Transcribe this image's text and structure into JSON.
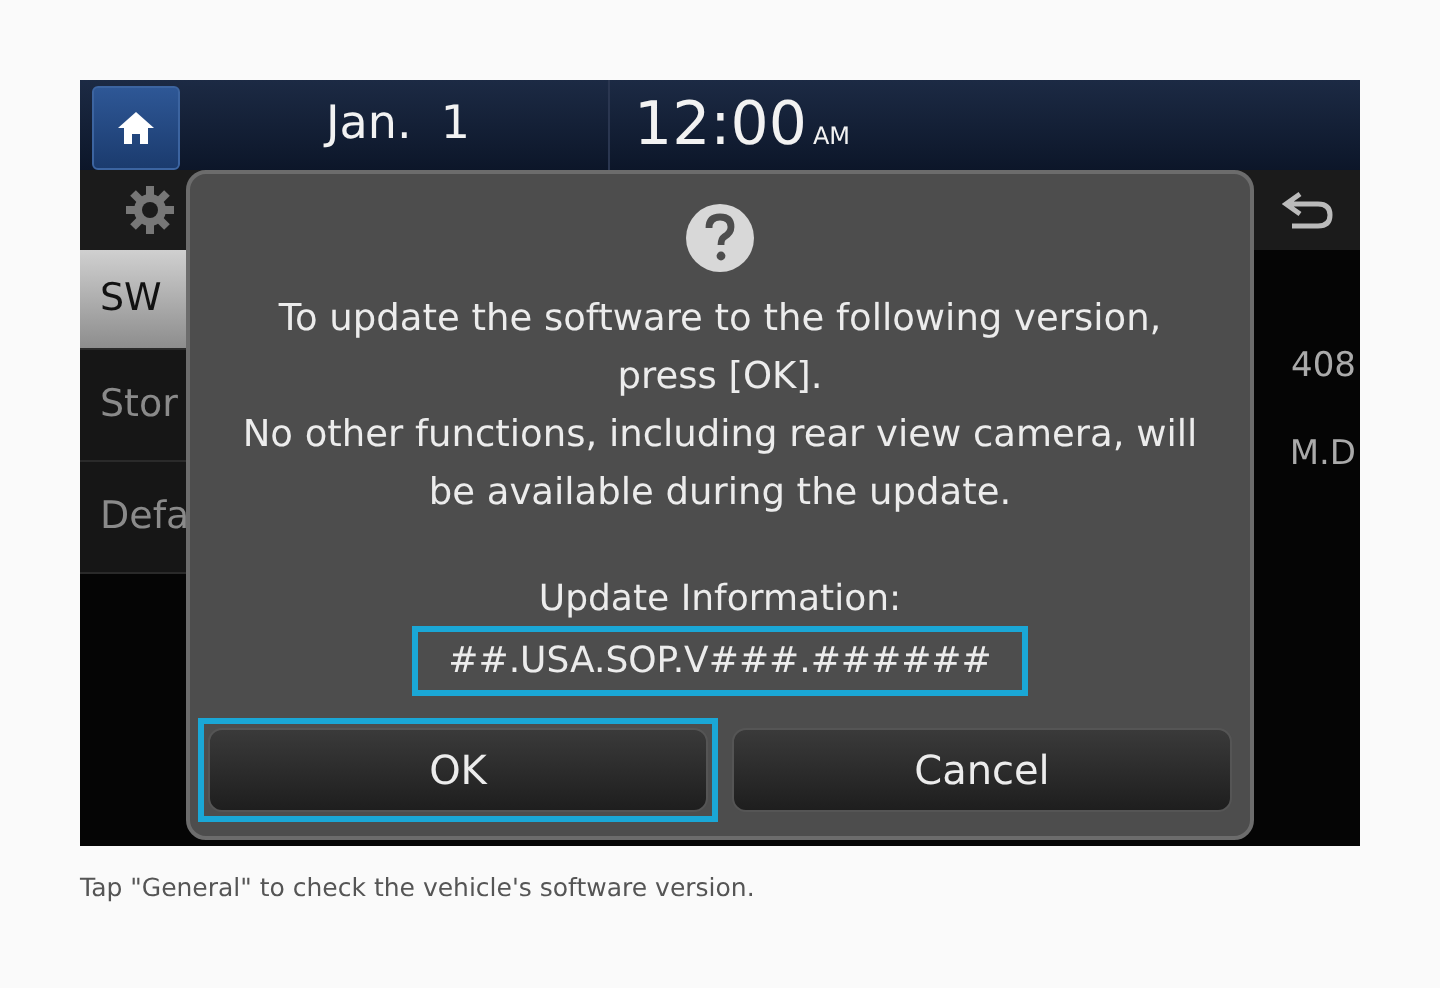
{
  "status_bar": {
    "date": "Jan.  1",
    "time": "12:00",
    "meridiem": "AM"
  },
  "sidebar": {
    "items": [
      {
        "label": "SW",
        "selected": true
      },
      {
        "label": "Stor",
        "selected": false
      },
      {
        "label": "Defa",
        "selected": false
      }
    ]
  },
  "background_values": [
    "408",
    "M.D"
  ],
  "dialog": {
    "message": [
      "To update the software to the following version,",
      "press [OK].",
      "No other functions, including rear view camera, will",
      "be available during the update."
    ],
    "info_label": "Update Information:",
    "version": {
      "text": "##.USA.SOP.V###.######",
      "highlighted": true
    },
    "buttons": [
      {
        "label": "OK",
        "highlighted": true
      },
      {
        "label": "Cancel",
        "highlighted": false
      }
    ]
  },
  "caption": "Tap \"General\" to check the vehicle's software version."
}
